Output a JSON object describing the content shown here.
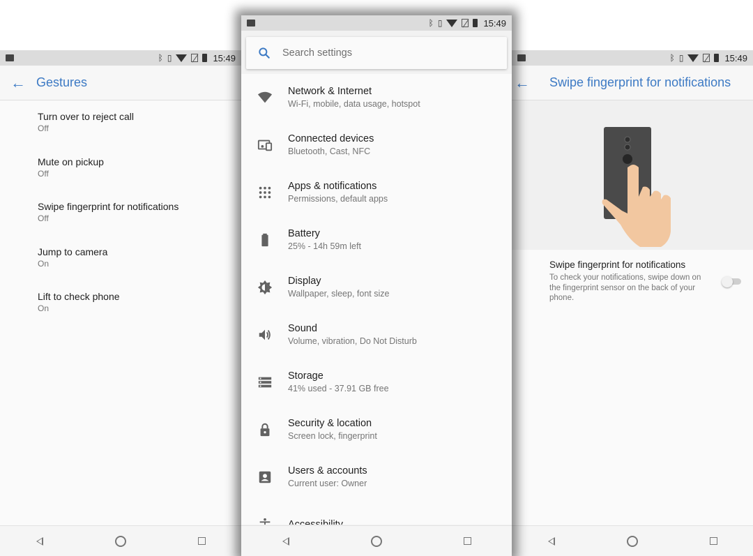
{
  "status_bar": {
    "time": "15:49"
  },
  "gestures_screen": {
    "title": "Gestures",
    "items": [
      {
        "title": "Turn over to reject call",
        "value": "Off"
      },
      {
        "title": "Mute on pickup",
        "value": "Off"
      },
      {
        "title": "Swipe fingerprint for notifications",
        "value": "Off"
      },
      {
        "title": "Jump to camera",
        "value": "On"
      },
      {
        "title": "Lift to check phone",
        "value": "On"
      }
    ]
  },
  "settings_screen": {
    "search_placeholder": "Search settings",
    "items": [
      {
        "title": "Network & Internet",
        "subtitle": "Wi-Fi, mobile, data usage, hotspot",
        "icon": "wifi-icon"
      },
      {
        "title": "Connected devices",
        "subtitle": "Bluetooth, Cast, NFC",
        "icon": "devices-icon"
      },
      {
        "title": "Apps & notifications",
        "subtitle": "Permissions, default apps",
        "icon": "apps-grid-icon"
      },
      {
        "title": "Battery",
        "subtitle": "25% - 14h 59m left",
        "icon": "battery-icon"
      },
      {
        "title": "Display",
        "subtitle": "Wallpaper, sleep, font size",
        "icon": "brightness-icon"
      },
      {
        "title": "Sound",
        "subtitle": "Volume, vibration, Do Not Disturb",
        "icon": "volume-icon"
      },
      {
        "title": "Storage",
        "subtitle": "41% used - 37.91 GB free",
        "icon": "storage-icon"
      },
      {
        "title": "Security & location",
        "subtitle": "Screen lock, fingerprint",
        "icon": "lock-icon"
      },
      {
        "title": "Users & accounts",
        "subtitle": "Current user: Owner",
        "icon": "account-icon"
      },
      {
        "title": "Accessibility",
        "subtitle": "",
        "icon": "accessibility-icon"
      }
    ]
  },
  "fingerprint_screen": {
    "title": "Swipe fingerprint for notifications",
    "setting_title": "Swipe fingerprint for notifications",
    "setting_description": "To check your notifications, swipe down on the fingerprint sensor on the back of your phone.",
    "toggle_on": false
  },
  "colors": {
    "accent": "#3d7ac4",
    "icon_gray": "#616161",
    "phone_body": "#4a4a4a",
    "hand": "#f2c7a0"
  }
}
